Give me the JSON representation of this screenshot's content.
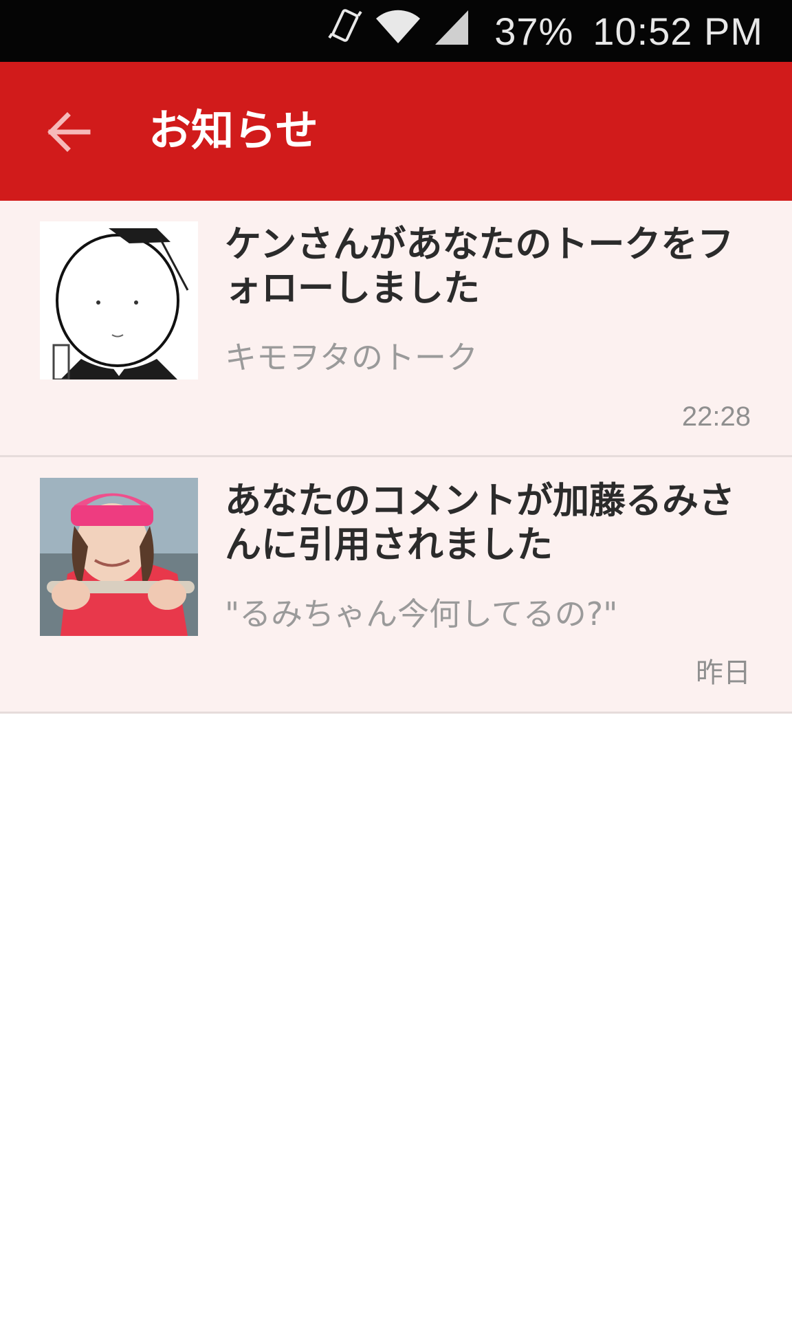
{
  "status_bar": {
    "battery": "37%",
    "time": "10:52 PM",
    "icons": [
      "vibrate-icon",
      "wifi-icon",
      "signal-icon"
    ]
  },
  "app_bar": {
    "back_icon": "arrow-left-icon",
    "title": "お知らせ",
    "color": "#d11b1b"
  },
  "notifications": [
    {
      "avatar": "bald-character-avatar",
      "title": "ケンさんがあなたのトークをフォローしました",
      "subtitle": "キモヲタのトーク",
      "time": "22:28"
    },
    {
      "avatar": "woman-holding-fish-avatar",
      "title": "あなたのコメントが加藤るみさんに引用されました",
      "subtitle": "\"るみちゃん今何してるの?\"",
      "time": "昨日"
    }
  ]
}
